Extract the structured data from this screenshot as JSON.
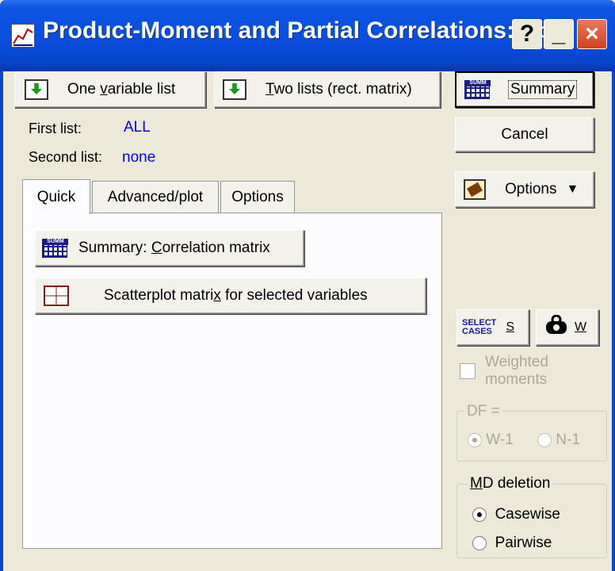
{
  "window": {
    "title": "Product-Moment and Partial Correlations: Spre",
    "help_btn": "?",
    "min_btn": "_",
    "close_btn": "×"
  },
  "toolbar": {
    "one_list_pre": "One ",
    "one_list_u": "v",
    "one_list_post": "ariable list",
    "two_lists_u": "T",
    "two_lists_post": "wo lists (rect. matrix)",
    "summary": "Summary",
    "summary_icon_text": "SUMM",
    "cancel": "Cancel",
    "options": "Options",
    "options_arrow": "▼"
  },
  "lists": {
    "first_label": "First list:",
    "first_value": "ALL",
    "second_label": "Second list:",
    "second_value": "none"
  },
  "tabs": [
    "Quick",
    "Advanced/plot",
    "Options"
  ],
  "quick": {
    "summary_pre": "Summary:  ",
    "summary_u": "C",
    "summary_post": "orrelation matrix",
    "scatter_pre": "Scatterplot matri",
    "scatter_u": "x",
    "scatter_post": " for selected variables"
  },
  "right": {
    "select_cases_line1": "SELECT",
    "select_cases_line2": "CASES",
    "select_cases_key": "S",
    "weights_key": "W",
    "weighted_label_line1": "Weighted",
    "weighted_label_line2": "moments",
    "df_title": "DF =",
    "df_opt1": "W-1",
    "df_opt2": "N-1",
    "md_title_u": "M",
    "md_title_post": "D deletion",
    "md_opt1": "Casewise",
    "md_opt2": "Pairwise"
  },
  "colors": {
    "titlebar": "#0a4fdd",
    "list_value": "#0000ff",
    "disabled": "#aca899"
  }
}
